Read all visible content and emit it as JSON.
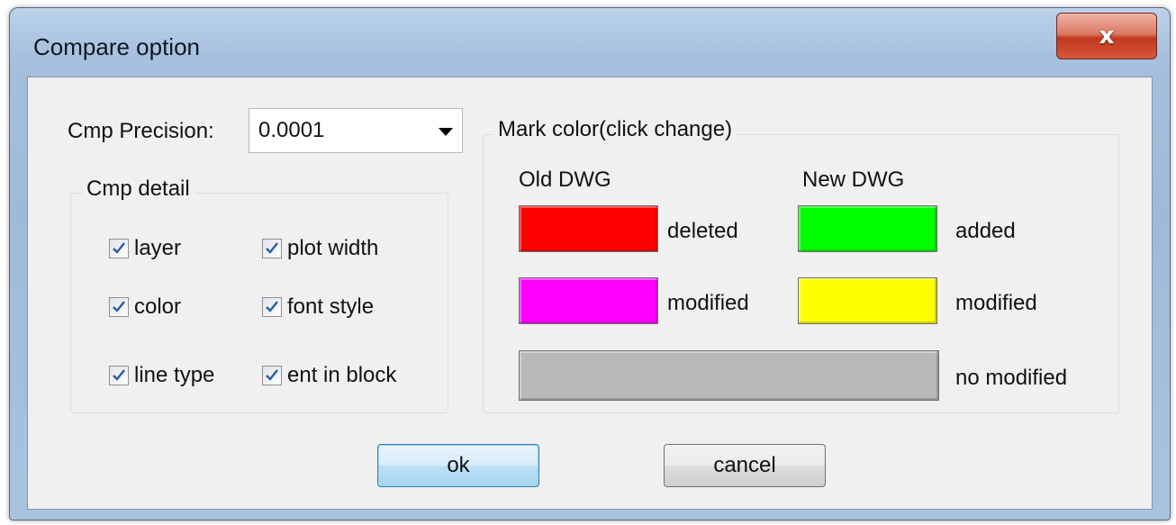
{
  "window": {
    "title": "Compare option",
    "close_glyph": "x"
  },
  "precision": {
    "label": "Cmp Precision:",
    "value": "0.0001"
  },
  "detail": {
    "title": "Cmp detail",
    "items": [
      {
        "label": "layer",
        "checked": true
      },
      {
        "label": "plot width",
        "checked": true
      },
      {
        "label": "color",
        "checked": true
      },
      {
        "label": "font style",
        "checked": true
      },
      {
        "label": "line type",
        "checked": true
      },
      {
        "label": "ent in block",
        "checked": true
      }
    ]
  },
  "mark": {
    "title": "Mark color(click change)",
    "old_header": "Old DWG",
    "new_header": "New DWG",
    "deleted_label": "deleted",
    "old_modified_label": "modified",
    "added_label": "added",
    "new_modified_label": "modified",
    "no_modified_label": "no modified",
    "colors": {
      "deleted": "#ff0000",
      "old_modified": "#ff00ff",
      "added": "#00ff00",
      "new_modified": "#ffff00",
      "no_modified": "#b9b9b9"
    }
  },
  "buttons": {
    "ok": "ok",
    "cancel": "cancel"
  }
}
